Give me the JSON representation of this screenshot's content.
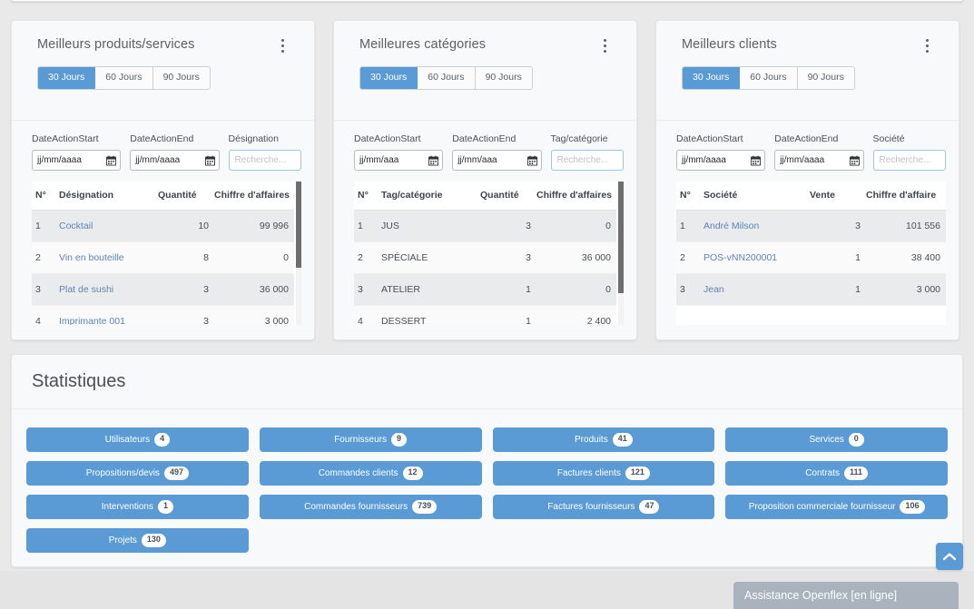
{
  "cards": [
    {
      "title": "Meilleurs produits/services",
      "kebab_icon": "kebab-menu-icon",
      "tabs": [
        {
          "label": "30 Jours",
          "active": true
        },
        {
          "label": "60 Jours",
          "active": false
        },
        {
          "label": "90 Jours",
          "active": false
        }
      ],
      "filters": {
        "start_label": "DateActionStart",
        "start_value": "jj/mm/aaaa",
        "end_label": "DateActionEnd",
        "end_value": "jj/mm/aaaa",
        "search_label": "Désignation",
        "search_value": "",
        "search_placeholder": "Recherche..."
      },
      "columns": [
        "N°",
        "Désignation",
        "Quantité",
        "Chiffre d'affaires"
      ],
      "rows": [
        {
          "n": "1",
          "name": "Cocktail",
          "qty": "10",
          "ca": "99 996"
        },
        {
          "n": "2",
          "name": "Vin en bouteille",
          "qty": "8",
          "ca": "0"
        },
        {
          "n": "3",
          "name": "Plat de sushi",
          "qty": "3",
          "ca": "36 000"
        },
        {
          "n": "4",
          "name": "Imprimante 001",
          "qty": "3",
          "ca": "3 000"
        }
      ],
      "scrollbar": {
        "thumb_top_pct": 0,
        "thumb_height_pct": 60
      }
    },
    {
      "title": "Meilleures catégories",
      "kebab_icon": "kebab-menu-icon",
      "tabs": [
        {
          "label": "30 Jours",
          "active": true
        },
        {
          "label": "60 Jours",
          "active": false
        },
        {
          "label": "90 Jours",
          "active": false
        }
      ],
      "filters": {
        "start_label": "DateActionStart",
        "start_value": "jj/mm/aaa",
        "end_label": "DateActionEnd",
        "end_value": "jj/mm/aaa",
        "search_label": "Tag/catégorie",
        "search_value": "",
        "search_placeholder": "Recherche..."
      },
      "columns": [
        "N°",
        "Tag/catégorie",
        "Quantité",
        "Chiffre d'affaires"
      ],
      "rows": [
        {
          "n": "1",
          "name": "JUS",
          "qty": "3",
          "ca": "0"
        },
        {
          "n": "2",
          "name": "SPÉCIALE",
          "qty": "3",
          "ca": "36 000"
        },
        {
          "n": "3",
          "name": "ATELIER",
          "qty": "1",
          "ca": "0"
        },
        {
          "n": "4",
          "name": "DESSERT",
          "qty": "1",
          "ca": "2 400"
        }
      ],
      "scrollbar": {
        "thumb_top_pct": 0,
        "thumb_height_pct": 78
      }
    },
    {
      "title": "Meilleurs clients",
      "kebab_icon": "kebab-menu-icon",
      "tabs": [
        {
          "label": "30 Jours",
          "active": true
        },
        {
          "label": "60 Jours",
          "active": false
        },
        {
          "label": "90 Jours",
          "active": false
        }
      ],
      "filters": {
        "start_label": "DateActionStart",
        "start_value": "jj/mm/aaaa",
        "end_label": "DateActionEnd",
        "end_value": "jj/mm/aaaa",
        "search_label": "Société",
        "search_value": "",
        "search_placeholder": "Recherche..."
      },
      "columns": [
        "N°",
        "Société",
        "Vente",
        "Chiffre d'affaire"
      ],
      "rows": [
        {
          "n": "1",
          "name": "André Milson",
          "qty": "3",
          "ca": "101 556"
        },
        {
          "n": "2",
          "name": "POS-vNN200001",
          "qty": "1",
          "ca": "38 400"
        },
        {
          "n": "3",
          "name": "Jean",
          "qty": "1",
          "ca": "3 000"
        }
      ],
      "scrollbar": null
    }
  ],
  "statistics": {
    "title": "Statistiques",
    "columns": [
      [
        {
          "label": "Utilisateurs",
          "count": "4"
        },
        {
          "label": "Propositions/devis",
          "count": "497"
        },
        {
          "label": "Interventions",
          "count": "1"
        },
        {
          "label": "Projets",
          "count": "130"
        }
      ],
      [
        {
          "label": "Fournisseurs",
          "count": "9"
        },
        {
          "label": "Commandes clients",
          "count": "12"
        },
        {
          "label": "Commandes fournisseurs",
          "count": "739"
        }
      ],
      [
        {
          "label": "Produits",
          "count": "41"
        },
        {
          "label": "Factures clients",
          "count": "121"
        },
        {
          "label": "Factures fournisseurs",
          "count": "47"
        }
      ],
      [
        {
          "label": "Services",
          "count": "0"
        },
        {
          "label": "Contrats",
          "count": "111"
        },
        {
          "label": "Proposition commerciale fournisseur",
          "count": "106"
        }
      ]
    ]
  },
  "scroll_top_button": {
    "icon": "chevron-up-icon"
  },
  "chat": {
    "label": "Assistance Openflex [en ligne]"
  },
  "colors": {
    "accent": "#5b9bd5",
    "card_bg": "#f8f9fa",
    "page_bg": "#e9e9e9",
    "link": "#5b85b5",
    "chat_bg": "#a9b2bd"
  }
}
